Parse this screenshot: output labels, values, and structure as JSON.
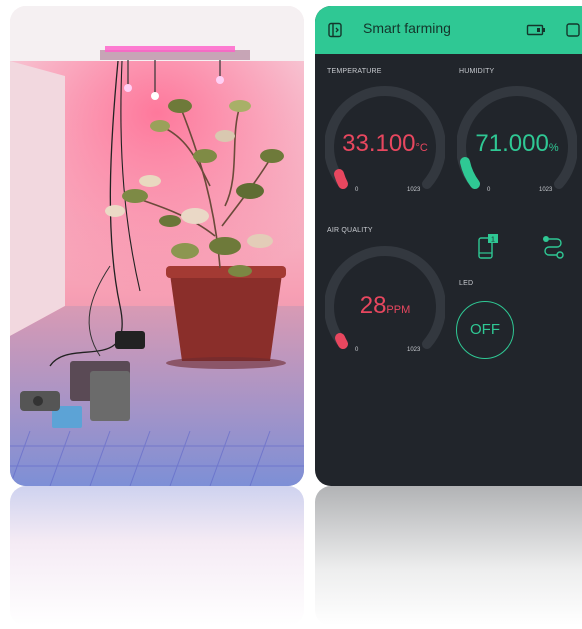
{
  "app": {
    "title": "Smart farming",
    "accent_color": "#2fc894",
    "alert_color": "#e8475f",
    "background_color": "#21252b"
  },
  "header_icons": [
    "device-frame-icon",
    "battery-icon",
    "window-icon"
  ],
  "widgets": {
    "temperature": {
      "label": "TEMPERATURE",
      "value": "33.100",
      "unit": "°C",
      "min": "0",
      "max": "1023",
      "color": "#e8475f"
    },
    "humidity": {
      "label": "HUMIDITY",
      "value": "71.000",
      "unit": "%",
      "min": "0",
      "max": "1023",
      "color": "#2fc894"
    },
    "air_quality": {
      "label": "AIR QUALITY",
      "value": "28",
      "unit": "PPM",
      "min": "0",
      "max": "1023",
      "color": "#e8475f"
    },
    "notification": {
      "badge": "1"
    },
    "led": {
      "label": "LED",
      "state": "OFF"
    }
  }
}
